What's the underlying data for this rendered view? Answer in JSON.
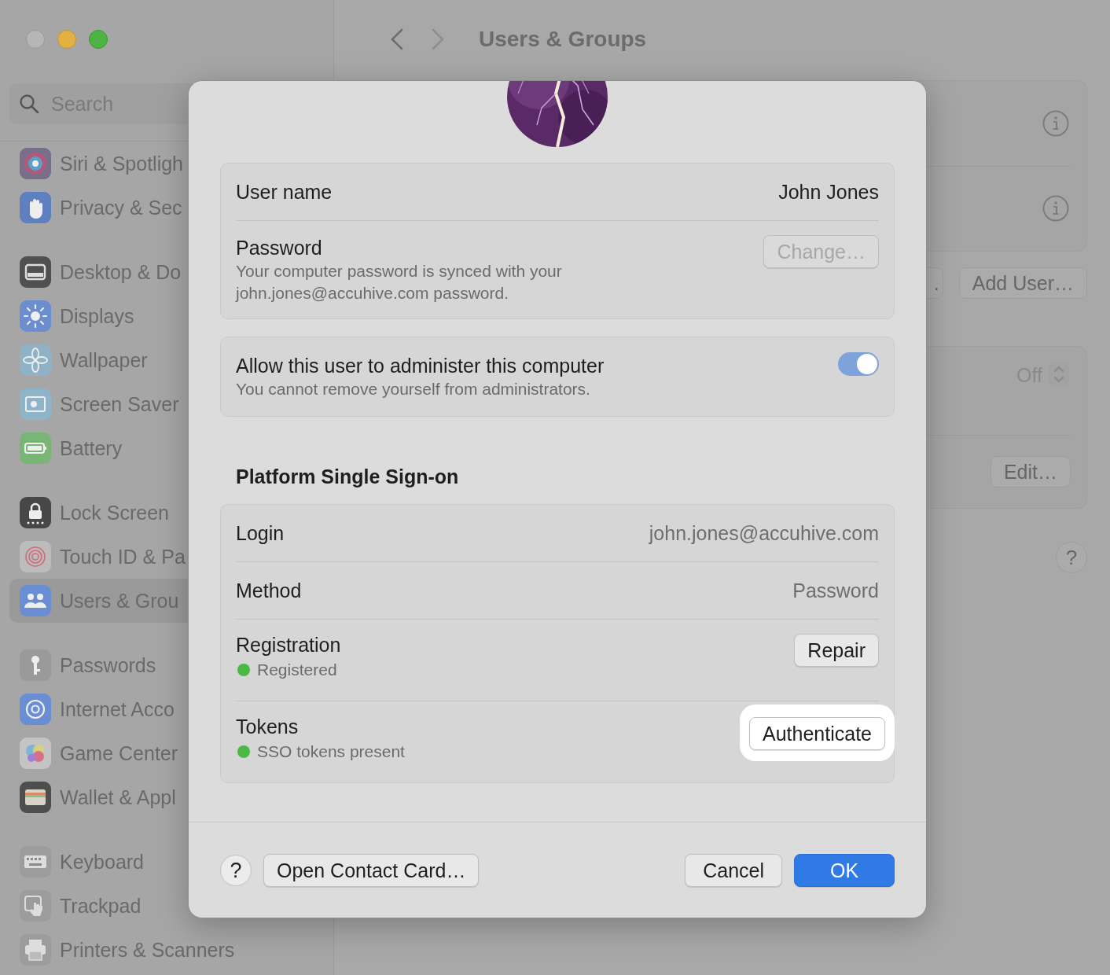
{
  "toolbar": {
    "title": "Users & Groups"
  },
  "sidebar": {
    "search": {
      "placeholder": "Search"
    },
    "groups": [
      [
        {
          "label": "Siri & Spotligh",
          "selected": false
        },
        {
          "label": "Privacy & Sec",
          "selected": false
        }
      ],
      [
        {
          "label": "Desktop & Do",
          "selected": false
        },
        {
          "label": "Displays",
          "selected": false
        },
        {
          "label": "Wallpaper",
          "selected": false
        },
        {
          "label": "Screen Saver",
          "selected": false
        },
        {
          "label": "Battery",
          "selected": false
        }
      ],
      [
        {
          "label": "Lock Screen",
          "selected": false
        },
        {
          "label": "Touch ID & Pa",
          "selected": false
        },
        {
          "label": "Users & Grou",
          "selected": true
        }
      ],
      [
        {
          "label": "Passwords",
          "selected": false
        },
        {
          "label": "Internet Acco",
          "selected": false
        },
        {
          "label": "Game Center",
          "selected": false
        },
        {
          "label": "Wallet & Appl",
          "selected": false
        }
      ],
      [
        {
          "label": "Keyboard",
          "selected": false
        },
        {
          "label": "Trackpad",
          "selected": false
        },
        {
          "label": "Printers & Scanners",
          "selected": false
        }
      ]
    ]
  },
  "main": {
    "buttons": [
      ".",
      "Add User…"
    ],
    "setting": {
      "value": "Off",
      "button": "Edit…"
    },
    "help": "?"
  },
  "dialog": {
    "account_rows": [
      {
        "kind": "value",
        "label": "User name",
        "value": "John Jones",
        "secondary": false
      },
      {
        "kind": "button",
        "label": "Password",
        "description": "Your computer password is synced with your john.jones@accuhive.com password.",
        "button": "Change…",
        "disabled": true
      }
    ],
    "admin": {
      "label": "Allow this user to administer this computer",
      "description": "You cannot remove yourself from administrators.",
      "on": true
    },
    "sso": {
      "heading": "Platform Single Sign-on",
      "rows": [
        {
          "kind": "value",
          "label": "Login",
          "value": "john.jones@accuhive.com",
          "secondary": true
        },
        {
          "kind": "value",
          "label": "Method",
          "value": "Password",
          "secondary": true
        },
        {
          "kind": "status",
          "label": "Registration",
          "status": "Registered",
          "color": "#4cb944",
          "button": "Repair",
          "highlighted": false
        },
        {
          "kind": "status",
          "label": "Tokens",
          "status": "SSO tokens present",
          "color": "#4cb944",
          "button": "Authenticate",
          "highlighted": true
        }
      ]
    },
    "footer": {
      "help": "?",
      "contact_button": "Open Contact Card…",
      "cancel": "Cancel",
      "ok": "OK"
    }
  }
}
